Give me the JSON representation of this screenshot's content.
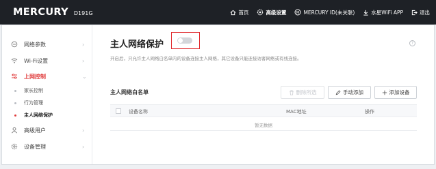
{
  "header": {
    "brand": "MERCURY",
    "model": "D191G",
    "nav": [
      {
        "label": "首页",
        "icon": "home-icon"
      },
      {
        "label": "高级设置",
        "icon": "gear-icon",
        "active": true
      },
      {
        "label": "MERCURY ID(未关联)",
        "icon": "mercury-id-icon"
      },
      {
        "label": "水星WiFi APP",
        "icon": "download-icon"
      },
      {
        "label": "退出",
        "icon": "logout-icon"
      }
    ]
  },
  "sidebar": {
    "items": [
      {
        "label": "网络参数",
        "icon": "network-icon"
      },
      {
        "label": "Wi-Fi设置",
        "icon": "wifi-icon"
      },
      {
        "label": "上网控制",
        "icon": "control-icon",
        "open": true
      },
      {
        "label": "高级用户",
        "icon": "user-icon"
      },
      {
        "label": "设备管理",
        "icon": "device-gear-icon"
      }
    ],
    "sub_items": [
      {
        "label": "家长控制"
      },
      {
        "label": "行为管理"
      },
      {
        "label": "主人网络保护",
        "active": true
      }
    ],
    "chevron_right": "›",
    "chevron_down": "⌄"
  },
  "main": {
    "title": "主人网络保护",
    "toggle_on": false,
    "help": "?",
    "description": "开启后，只允许主人网络白名单内的设备连接主人网络，其它设备只能连接访客网络或有线连接。",
    "section_title": "主人网络白名单",
    "buttons": {
      "delete": "删除所选",
      "manual_add": "手动添加",
      "add_device": "添加设备"
    },
    "table": {
      "columns": [
        "设备名称",
        "MAC地址",
        "操作"
      ],
      "empty_text": "暂无数据"
    }
  },
  "colors": {
    "header_bg": "#1e2126",
    "accent_red": "#e03c3c",
    "highlight_box": "#e0272b"
  }
}
